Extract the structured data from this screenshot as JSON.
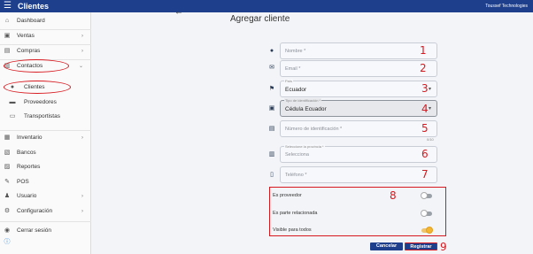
{
  "header": {
    "menu_icon": "hamburger-icon",
    "title": "Clientes",
    "company": "Toussef Technologies"
  },
  "sidebar": {
    "items": [
      {
        "label": "Dashboard",
        "icon": "home-icon"
      },
      {
        "label": "Ventas",
        "icon": "bag-icon"
      },
      {
        "label": "Compras",
        "icon": "cart-icon"
      },
      {
        "label": "Contactos",
        "icon": "contacts-icon"
      },
      {
        "label": "Clientes",
        "icon": "person-icon"
      },
      {
        "label": "Proveedores",
        "icon": "truck-icon"
      },
      {
        "label": "Transportistas",
        "icon": "id-card-icon"
      },
      {
        "label": "Inventario",
        "icon": "box-icon"
      },
      {
        "label": "Bancos",
        "icon": "bank-icon"
      },
      {
        "label": "Reportes",
        "icon": "report-icon"
      },
      {
        "label": "POS",
        "icon": "pos-icon"
      },
      {
        "label": "Usuario",
        "icon": "user-icon"
      },
      {
        "label": "Configuración",
        "icon": "gear-icon"
      },
      {
        "label": "Cerrar sesión",
        "icon": "logout-icon"
      }
    ]
  },
  "form": {
    "title": "Agregar cliente",
    "nombre_placeholder": "Nombre *",
    "email_placeholder": "Email *",
    "pais_label": "País",
    "pais_value": "Ecuador",
    "tipo_label": "Tipo de identificación *",
    "tipo_value": "Cédula Ecuador",
    "numero_placeholder": "Número de identificación *",
    "counter": "0/10",
    "ciudad_label": "Seleccione la provincia *",
    "ciudad_placeholder": "Selecciona",
    "telefono_placeholder": "Teléfono *",
    "toggles": [
      {
        "label": "Es proveedor",
        "on": false
      },
      {
        "label": "Es parte relacionada",
        "on": false
      },
      {
        "label": "Visible para todos",
        "on": true
      }
    ],
    "cancel_label": "Cancelar",
    "submit_label": "Registrar"
  },
  "annotations": [
    "1",
    "2",
    "3",
    "4",
    "5",
    "6",
    "7",
    "8",
    "9"
  ],
  "colors": {
    "topbar": "#1e3f8c",
    "accent_red": "#d7191f",
    "toggle_on": "#f4b533"
  }
}
